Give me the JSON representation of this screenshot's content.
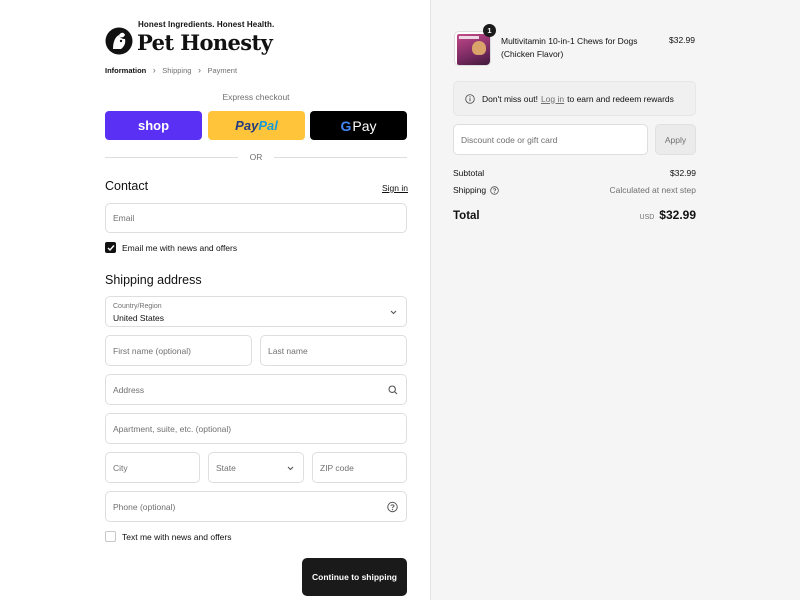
{
  "logo": {
    "tagline": "Honest Ingredients. Honest Health.",
    "brand": "Pet Honesty"
  },
  "breadcrumb": [
    {
      "label": "Information",
      "active": true
    },
    {
      "label": "Shipping",
      "active": false
    },
    {
      "label": "Payment",
      "active": false
    }
  ],
  "express": {
    "title": "Express checkout",
    "shop_label": "shop",
    "paypal_part1": "Pay",
    "paypal_part2": "Pal",
    "gpay_label": "Pay",
    "or_label": "OR"
  },
  "contact": {
    "title": "Contact",
    "signin_label": "Sign in",
    "email_placeholder": "Email",
    "newsletter_label": "Email me with news and offers",
    "newsletter_checked": true
  },
  "shipping": {
    "title": "Shipping address",
    "country_label": "Country/Region",
    "country_value": "United States",
    "first_name_placeholder": "First name (optional)",
    "last_name_placeholder": "Last name",
    "address_placeholder": "Address",
    "apartment_placeholder": "Apartment, suite, etc. (optional)",
    "city_placeholder": "City",
    "state_placeholder": "State",
    "zip_placeholder": "ZIP code",
    "phone_placeholder": "Phone (optional)",
    "text_offers_label": "Text me with news and offers",
    "text_offers_checked": false,
    "continue_label": "Continue to shipping"
  },
  "cart": {
    "item": {
      "name": "Multivitamin 10-in-1 Chews for Dogs (Chicken Flavor)",
      "price": "$32.99",
      "quantity": "1"
    },
    "rewards": {
      "prefix": "Don't miss out!",
      "link": "Log in",
      "suffix": "to earn and redeem rewards"
    },
    "discount_placeholder": "Discount code or gift card",
    "apply_label": "Apply",
    "subtotal_label": "Subtotal",
    "subtotal_value": "$32.99",
    "shipping_label": "Shipping",
    "shipping_value": "Calculated at next step",
    "total_label": "Total",
    "currency": "USD",
    "total_value": "$32.99"
  },
  "colors": {
    "shop": "#5a31f4",
    "paypal": "#ffc439",
    "gpay": "#000000",
    "primary_button": "#1a1a1a",
    "summary_bg": "#f5f5f5"
  }
}
